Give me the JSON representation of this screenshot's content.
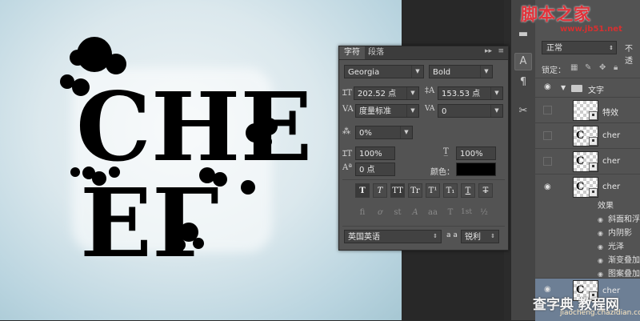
{
  "canvas": {
    "art_text_line1": "CHE",
    "art_text_line2": "EΓ"
  },
  "character_panel": {
    "tabs": [
      "字符",
      "段落"
    ],
    "collapse_icon": "double-chevron-icon",
    "font_family": "Georgia",
    "font_style": "Bold",
    "font_size": "202.52 点",
    "leading": "153.53 点",
    "kerning": "度量标准",
    "tracking": "0",
    "baseline_shift_scale": "0%",
    "vertical_scale": "100%",
    "horizontal_scale": "100%",
    "baseline_shift": "0 点",
    "color_label": "颜色：",
    "text_color": "#000000",
    "style_buttons": [
      "T",
      "T",
      "TT",
      "Tr",
      "T¹",
      "T₁",
      "T",
      "T"
    ],
    "opentype_buttons": [
      "fi",
      "ơ",
      "st",
      "A",
      "aa",
      "T",
      "1st",
      "½"
    ],
    "language": "英国英语",
    "aa_label": "a a",
    "anti_alias": "锐利"
  },
  "tool_strip": {
    "tools": [
      "layer-comp-icon",
      "character-icon",
      "paragraph-icon",
      "tools-icon"
    ],
    "labels": [
      "▬",
      "A",
      "¶",
      "✂"
    ]
  },
  "layers_panel": {
    "blend_mode": "正常",
    "opacity_label": "不透",
    "lock_label": "锁定：",
    "layers": [
      {
        "name": "文字",
        "type": "group",
        "visible": true
      },
      {
        "name": "特效",
        "type": "smart",
        "visible": false
      },
      {
        "name": "cher",
        "type": "smart",
        "visible": false
      },
      {
        "name": "cher",
        "type": "smart",
        "visible": false
      },
      {
        "name": "cher",
        "type": "smart",
        "visible": true
      },
      {
        "name": "cher",
        "type": "smart",
        "visible": true
      }
    ],
    "effects_label": "效果",
    "effects": [
      "斜面和浮",
      "内阴影",
      "光泽",
      "渐变叠加",
      "图案叠加"
    ]
  },
  "watermarks": {
    "top": "脚本之家",
    "top_url": "www.jb51.net",
    "bottom": "查字典 教程网",
    "bottom_url": "jiaocheng.chazidian.com"
  }
}
